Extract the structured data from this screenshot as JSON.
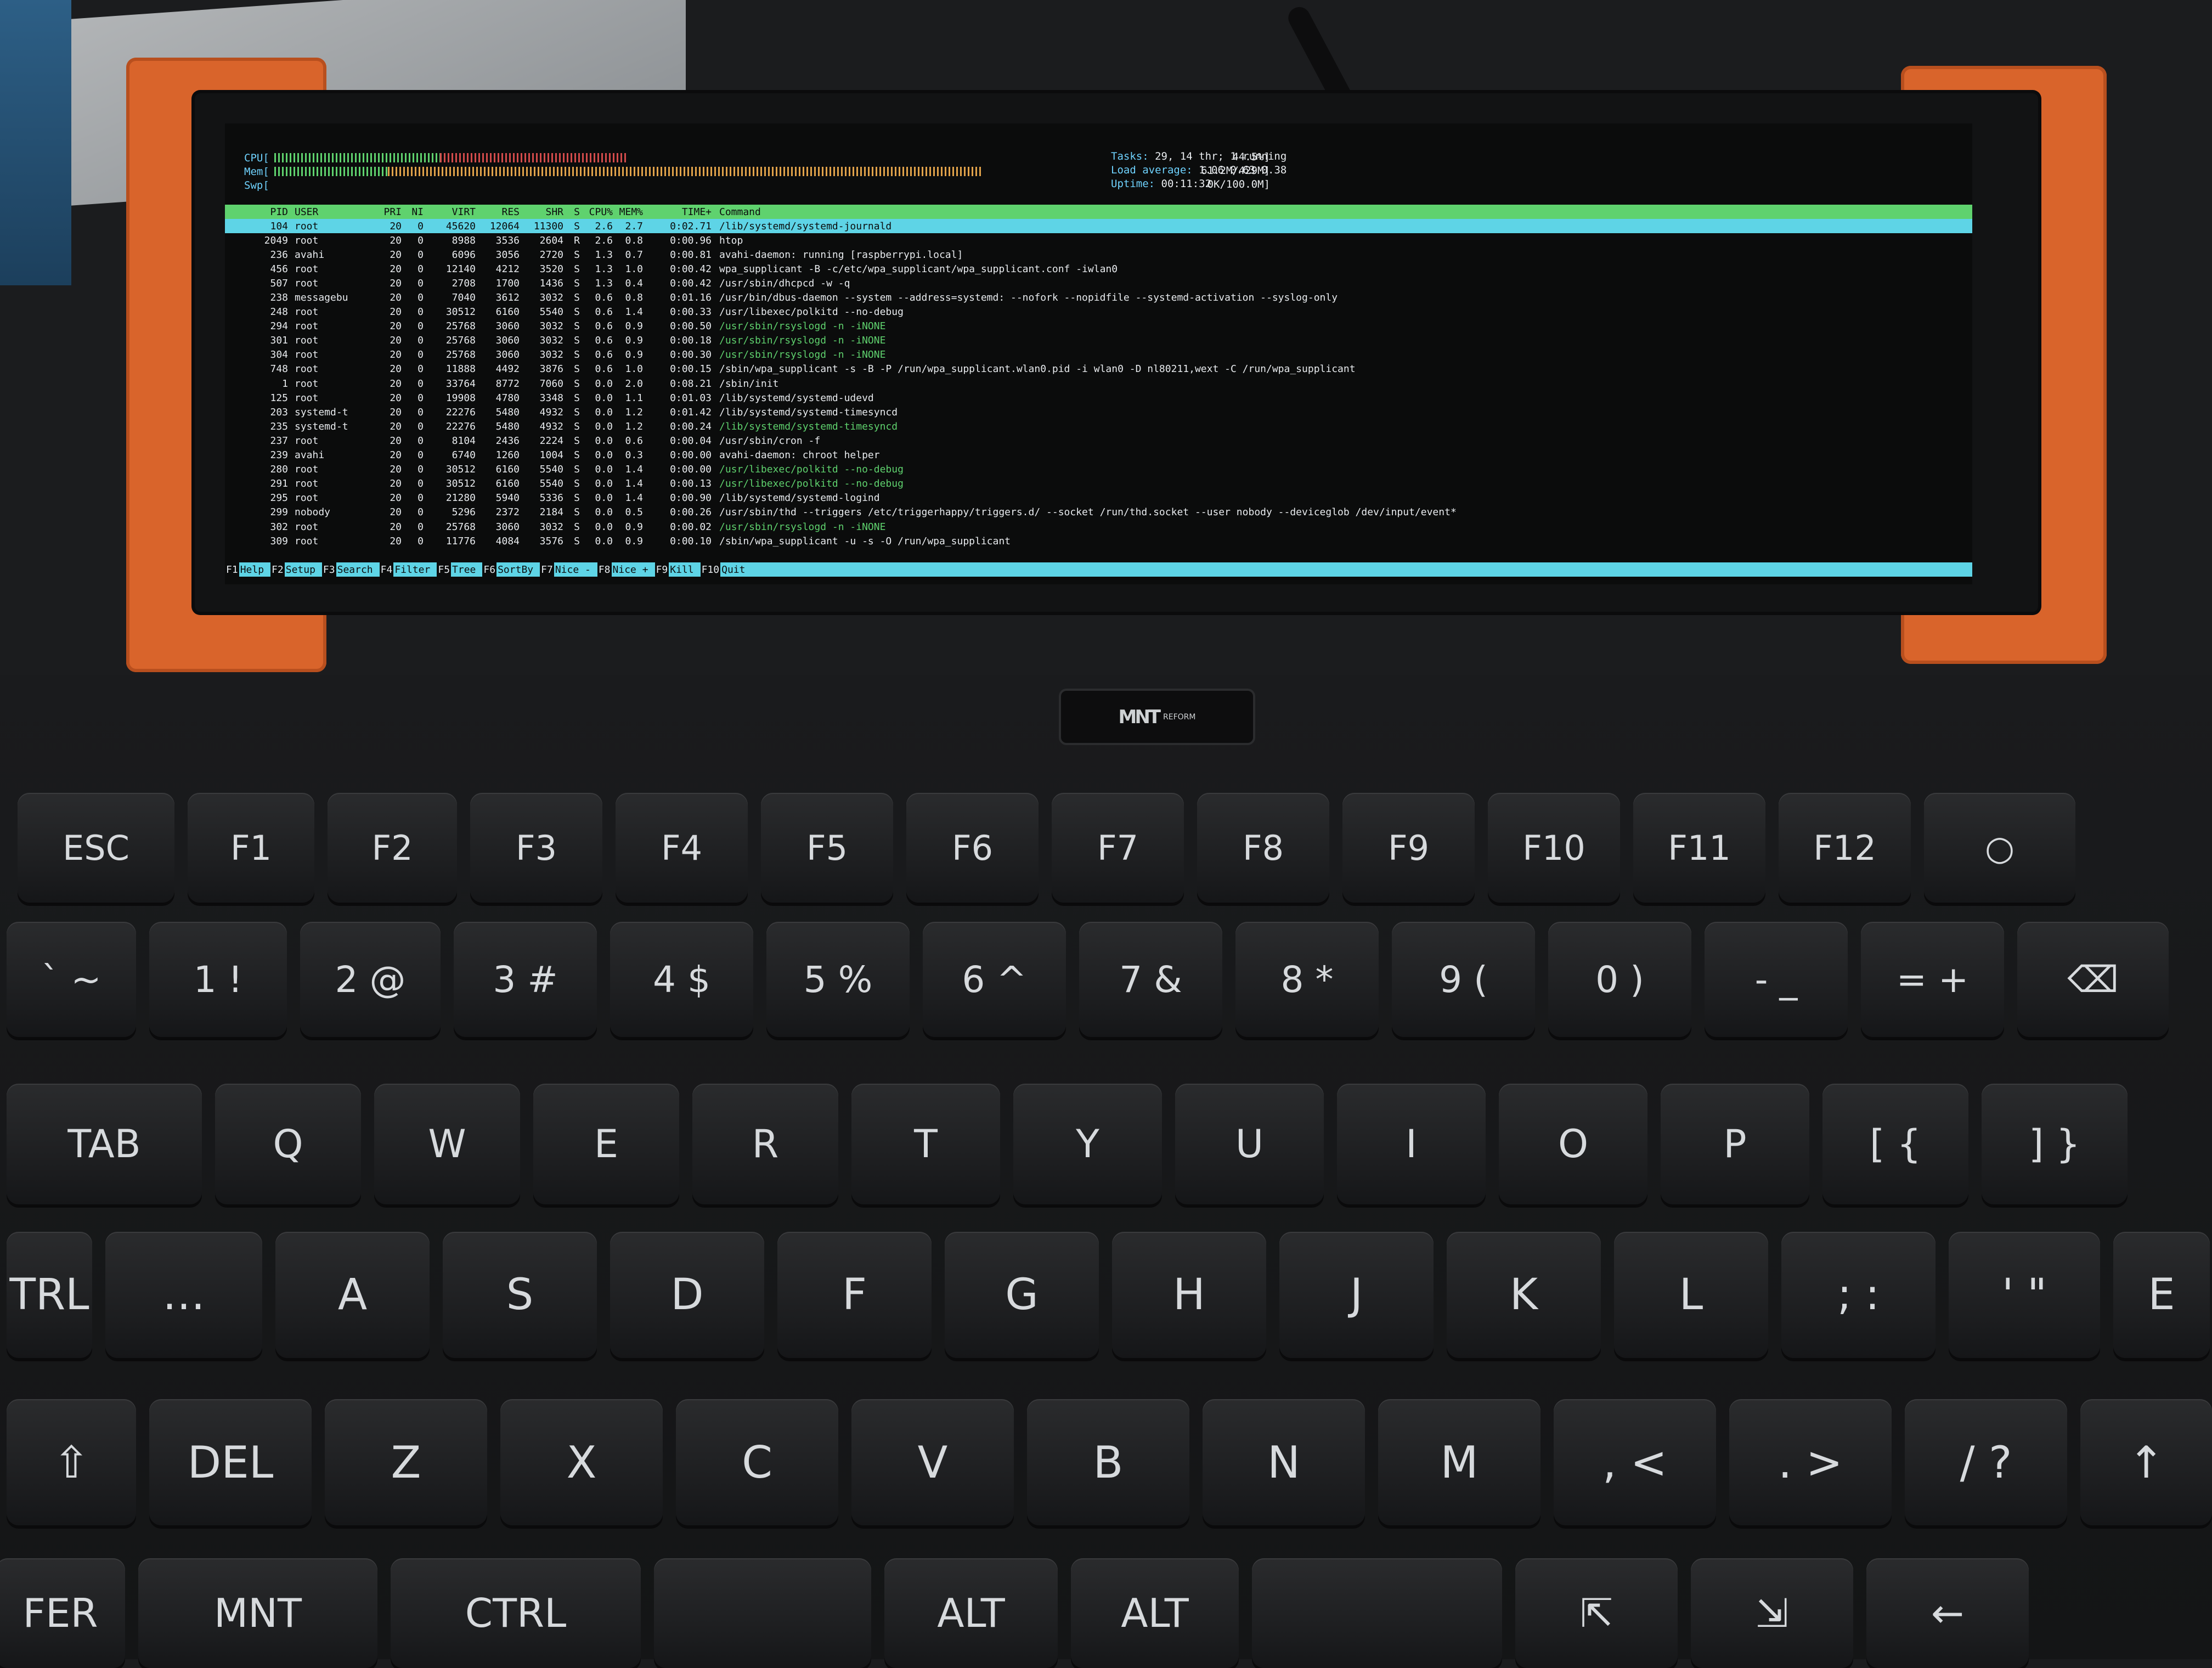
{
  "htop": {
    "cpu_label": "CPU[",
    "mem_label": "Mem[",
    "swp_label": "Swp[",
    "cpu_value": "44.5%]",
    "mem_value": "61.2M/429M]",
    "swp_value": "0K/100.0M]",
    "tasks_label": "Tasks:",
    "tasks_value": "29, 14 thr; 1 running",
    "load_label": "Load average:",
    "load_value": "1.06 0.63 0.38",
    "uptime_label": "Uptime:",
    "uptime_value": "00:11:32",
    "cpu_level": 0.445,
    "mem_level": 0.143,
    "columns": [
      "PID",
      "USER",
      "PRI",
      "NI",
      "VIRT",
      "RES",
      "SHR",
      "S",
      "CPU%",
      "MEM%",
      "TIME+",
      "Command"
    ],
    "rows": [
      {
        "pid": "104",
        "user": "root",
        "pri": "20",
        "ni": "0",
        "virt": "45620",
        "res": "12064",
        "shr": "11300",
        "s": "S",
        "cpu": "2.6",
        "mem": "2.7",
        "time": "0:02.71",
        "cmd": "/lib/systemd/systemd-journald",
        "selected": true
      },
      {
        "pid": "2049",
        "user": "root",
        "pri": "20",
        "ni": "0",
        "virt": "8988",
        "res": "3536",
        "shr": "2604",
        "s": "R",
        "cpu": "2.6",
        "mem": "0.8",
        "time": "0:00.96",
        "cmd": "htop"
      },
      {
        "pid": "236",
        "user": "avahi",
        "pri": "20",
        "ni": "0",
        "virt": "6096",
        "res": "3056",
        "shr": "2720",
        "s": "S",
        "cpu": "1.3",
        "mem": "0.7",
        "time": "0:00.81",
        "cmd": "avahi-daemon: running [raspberrypi.local]"
      },
      {
        "pid": "456",
        "user": "root",
        "pri": "20",
        "ni": "0",
        "virt": "12140",
        "res": "4212",
        "shr": "3520",
        "s": "S",
        "cpu": "1.3",
        "mem": "1.0",
        "time": "0:00.42",
        "cmd": "wpa_supplicant -B -c/etc/wpa_supplicant/wpa_supplicant.conf -iwlan0"
      },
      {
        "pid": "507",
        "user": "root",
        "pri": "20",
        "ni": "0",
        "virt": "2708",
        "res": "1700",
        "shr": "1436",
        "s": "S",
        "cpu": "1.3",
        "mem": "0.4",
        "time": "0:00.42",
        "cmd": "/usr/sbin/dhcpcd -w -q"
      },
      {
        "pid": "238",
        "user": "messagebu",
        "pri": "20",
        "ni": "0",
        "virt": "7040",
        "res": "3612",
        "shr": "3032",
        "s": "S",
        "cpu": "0.6",
        "mem": "0.8",
        "time": "0:01.16",
        "cmd": "/usr/bin/dbus-daemon --system --address=systemd: --nofork --nopidfile --systemd-activation --syslog-only"
      },
      {
        "pid": "248",
        "user": "root",
        "pri": "20",
        "ni": "0",
        "virt": "30512",
        "res": "6160",
        "shr": "5540",
        "s": "S",
        "cpu": "0.6",
        "mem": "1.4",
        "time": "0:00.33",
        "cmd": "/usr/libexec/polkitd --no-debug"
      },
      {
        "pid": "294",
        "user": "root",
        "pri": "20",
        "ni": "0",
        "virt": "25768",
        "res": "3060",
        "shr": "3032",
        "s": "S",
        "cpu": "0.6",
        "mem": "0.9",
        "time": "0:00.50",
        "cmd": "/usr/sbin/rsyslogd -n -iNONE",
        "green": true
      },
      {
        "pid": "301",
        "user": "root",
        "pri": "20",
        "ni": "0",
        "virt": "25768",
        "res": "3060",
        "shr": "3032",
        "s": "S",
        "cpu": "0.6",
        "mem": "0.9",
        "time": "0:00.18",
        "cmd": "/usr/sbin/rsyslogd -n -iNONE",
        "green": true
      },
      {
        "pid": "304",
        "user": "root",
        "pri": "20",
        "ni": "0",
        "virt": "25768",
        "res": "3060",
        "shr": "3032",
        "s": "S",
        "cpu": "0.6",
        "mem": "0.9",
        "time": "0:00.30",
        "cmd": "/usr/sbin/rsyslogd -n -iNONE",
        "green": true
      },
      {
        "pid": "748",
        "user": "root",
        "pri": "20",
        "ni": "0",
        "virt": "11888",
        "res": "4492",
        "shr": "3876",
        "s": "S",
        "cpu": "0.6",
        "mem": "1.0",
        "time": "0:00.15",
        "cmd": "/sbin/wpa_supplicant -s -B -P /run/wpa_supplicant.wlan0.pid -i wlan0 -D nl80211,wext -C /run/wpa_supplicant"
      },
      {
        "pid": "1",
        "user": "root",
        "pri": "20",
        "ni": "0",
        "virt": "33764",
        "res": "8772",
        "shr": "7060",
        "s": "S",
        "cpu": "0.0",
        "mem": "2.0",
        "time": "0:08.21",
        "cmd": "/sbin/init"
      },
      {
        "pid": "125",
        "user": "root",
        "pri": "20",
        "ni": "0",
        "virt": "19908",
        "res": "4780",
        "shr": "3348",
        "s": "S",
        "cpu": "0.0",
        "mem": "1.1",
        "time": "0:01.03",
        "cmd": "/lib/systemd/systemd-udevd"
      },
      {
        "pid": "203",
        "user": "systemd-t",
        "pri": "20",
        "ni": "0",
        "virt": "22276",
        "res": "5480",
        "shr": "4932",
        "s": "S",
        "cpu": "0.0",
        "mem": "1.2",
        "time": "0:01.42",
        "cmd": "/lib/systemd/systemd-timesyncd"
      },
      {
        "pid": "235",
        "user": "systemd-t",
        "pri": "20",
        "ni": "0",
        "virt": "22276",
        "res": "5480",
        "shr": "4932",
        "s": "S",
        "cpu": "0.0",
        "mem": "1.2",
        "time": "0:00.24",
        "cmd": "/lib/systemd/systemd-timesyncd",
        "green": true
      },
      {
        "pid": "237",
        "user": "root",
        "pri": "20",
        "ni": "0",
        "virt": "8104",
        "res": "2436",
        "shr": "2224",
        "s": "S",
        "cpu": "0.0",
        "mem": "0.6",
        "time": "0:00.04",
        "cmd": "/usr/sbin/cron -f"
      },
      {
        "pid": "239",
        "user": "avahi",
        "pri": "20",
        "ni": "0",
        "virt": "6740",
        "res": "1260",
        "shr": "1004",
        "s": "S",
        "cpu": "0.0",
        "mem": "0.3",
        "time": "0:00.00",
        "cmd": "avahi-daemon: chroot helper"
      },
      {
        "pid": "280",
        "user": "root",
        "pri": "20",
        "ni": "0",
        "virt": "30512",
        "res": "6160",
        "shr": "5540",
        "s": "S",
        "cpu": "0.0",
        "mem": "1.4",
        "time": "0:00.00",
        "cmd": "/usr/libexec/polkitd --no-debug",
        "green": true
      },
      {
        "pid": "291",
        "user": "root",
        "pri": "20",
        "ni": "0",
        "virt": "30512",
        "res": "6160",
        "shr": "5540",
        "s": "S",
        "cpu": "0.0",
        "mem": "1.4",
        "time": "0:00.13",
        "cmd": "/usr/libexec/polkitd --no-debug",
        "green": true
      },
      {
        "pid": "295",
        "user": "root",
        "pri": "20",
        "ni": "0",
        "virt": "21280",
        "res": "5940",
        "shr": "5336",
        "s": "S",
        "cpu": "0.0",
        "mem": "1.4",
        "time": "0:00.90",
        "cmd": "/lib/systemd/systemd-logind"
      },
      {
        "pid": "299",
        "user": "nobody",
        "pri": "20",
        "ni": "0",
        "virt": "5296",
        "res": "2372",
        "shr": "2184",
        "s": "S",
        "cpu": "0.0",
        "mem": "0.5",
        "time": "0:00.26",
        "cmd": "/usr/sbin/thd --triggers /etc/triggerhappy/triggers.d/ --socket /run/thd.socket --user nobody --deviceglob /dev/input/event*"
      },
      {
        "pid": "302",
        "user": "root",
        "pri": "20",
        "ni": "0",
        "virt": "25768",
        "res": "3060",
        "shr": "3032",
        "s": "S",
        "cpu": "0.0",
        "mem": "0.9",
        "time": "0:00.02",
        "cmd": "/usr/sbin/rsyslogd -n -iNONE",
        "green": true
      },
      {
        "pid": "309",
        "user": "root",
        "pri": "20",
        "ni": "0",
        "virt": "11776",
        "res": "4084",
        "shr": "3576",
        "s": "S",
        "cpu": "0.0",
        "mem": "0.9",
        "time": "0:00.10",
        "cmd": "/sbin/wpa_supplicant -u -s -O /run/wpa_supplicant"
      }
    ],
    "fkeys": [
      {
        "num": "F1",
        "label": "Help"
      },
      {
        "num": "F2",
        "label": "Setup"
      },
      {
        "num": "F3",
        "label": "Search"
      },
      {
        "num": "F4",
        "label": "Filter"
      },
      {
        "num": "F5",
        "label": "Tree"
      },
      {
        "num": "F6",
        "label": "SortBy"
      },
      {
        "num": "F7",
        "label": "Nice -"
      },
      {
        "num": "F8",
        "label": "Nice +"
      },
      {
        "num": "F9",
        "label": "Kill"
      },
      {
        "num": "F10",
        "label": "Quit"
      }
    ]
  },
  "laptop": {
    "logo_mark": "MNT",
    "logo_text": "REFORM"
  },
  "keyboard": {
    "rows": [
      [
        "ESC",
        "F1",
        "F2",
        "F3",
        "F4",
        "F5",
        "F6",
        "F7",
        "F8",
        "F9",
        "F10",
        "F11",
        "F12",
        "○"
      ],
      [
        "` ~",
        "1 !",
        "2 @",
        "3 #",
        "4 $",
        "5 %",
        "6 ^",
        "7 &",
        "8 *",
        "9 (",
        "0 )",
        "- _",
        "= +",
        "⌫"
      ],
      [
        "TAB",
        "Q",
        "W",
        "E",
        "R",
        "T",
        "Y",
        "U",
        "I",
        "O",
        "P",
        "[ {",
        "] }"
      ],
      [
        "TRL",
        "…",
        "A",
        "S",
        "D",
        "F",
        "G",
        "H",
        "J",
        "K",
        "L",
        "; :",
        "' \"",
        "E"
      ],
      [
        "⇧",
        "DEL",
        "Z",
        "X",
        "C",
        "V",
        "B",
        "N",
        "M",
        ", <",
        ". >",
        "/ ?",
        "↑"
      ],
      [
        "FER",
        "MNT",
        "CTRL",
        "",
        "ALT",
        "ALT",
        "",
        "⇱",
        "⇲",
        "←"
      ]
    ]
  },
  "colors": {
    "bracket": "#d9642b",
    "htop_green": "#5fd26e",
    "htop_cyan": "#5ed4e6"
  }
}
